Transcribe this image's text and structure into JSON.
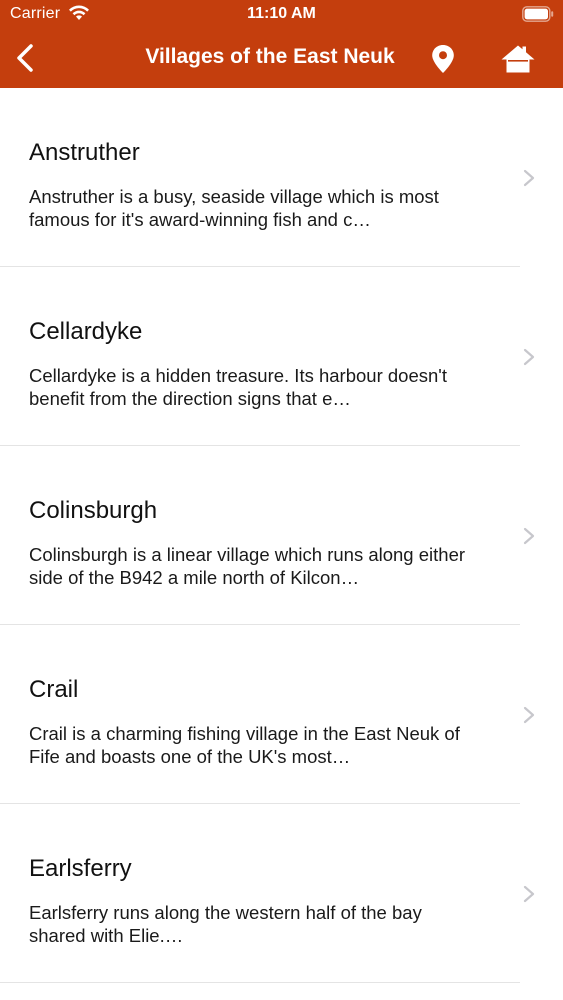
{
  "status_bar": {
    "carrier": "Carrier",
    "time": "11:10 AM"
  },
  "nav": {
    "title": "Villages of the East Neuk",
    "back_icon": "chevron-left-icon",
    "map_icon": "map-pin-icon",
    "home_icon": "home-icon"
  },
  "colors": {
    "header": "#c43e0d",
    "text": "#111111",
    "chevron": "#c7c7cc"
  },
  "villages": [
    {
      "title": "Anstruther",
      "desc": "Anstruther is a busy, seaside village which is most famous for it's award-winning fish and c…"
    },
    {
      "title": "Cellardyke",
      "desc": "Cellardyke is a hidden treasure. Its harbour doesn't benefit from the direction signs that e…"
    },
    {
      "title": "Colinsburgh",
      "desc": "Colinsburgh is a linear village which runs along either side of the B942 a mile north of Kilcon…"
    },
    {
      "title": "Crail",
      "desc": "Crail is a charming fishing village in the East Neuk of Fife and boasts one of the UK's most…"
    },
    {
      "title": "Earlsferry",
      "desc": "Earlsferry runs along the western half of the bay shared with Elie.…"
    }
  ]
}
